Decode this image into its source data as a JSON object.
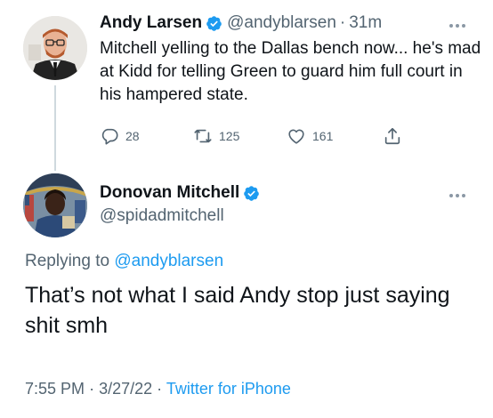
{
  "tweet": {
    "author_name": "Andy Larsen",
    "handle": "@andyblarsen",
    "separator": "·",
    "time": "31m",
    "text": "Mitchell yelling to the Dallas bench now... he's mad at Kidd for telling Green to guard him full court in his hampered state.",
    "reply_count": "28",
    "retweet_count": "125",
    "like_count": "161",
    "icons": [
      "reply-icon",
      "retweet-icon",
      "like-icon",
      "share-icon",
      "more-icon",
      "verified-badge-icon"
    ]
  },
  "reply": {
    "author_name": "Donovan Mitchell",
    "handle": "@spidadmitchell",
    "replying_prefix": "Replying to ",
    "replying_to": "@andyblarsen",
    "text": "That’s not what I said Andy stop just saying shit smh",
    "time": "7:55 PM",
    "separator": "·",
    "date": "3/27/22",
    "separator2": "·",
    "source": "Twitter for iPhone"
  },
  "colors": {
    "accent": "#1d9bf0",
    "secondary_text": "#536471",
    "primary_text": "#0f1419",
    "divider": "#cfd9de"
  }
}
